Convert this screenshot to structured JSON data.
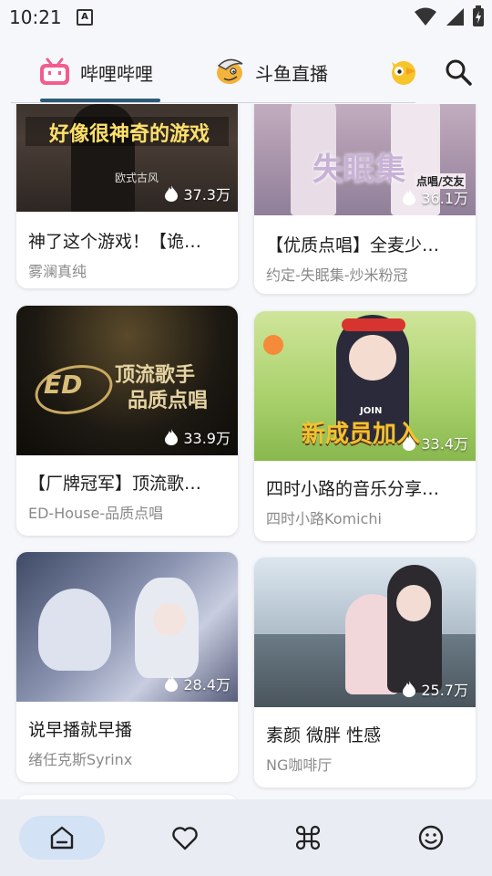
{
  "status_bar": {
    "time": "10:21",
    "notification_letter": "A",
    "icons": [
      "wifi-icon",
      "signal-icon",
      "battery-charging-icon"
    ]
  },
  "tabs": [
    {
      "label": "哔哩哔哩",
      "icon": "bilibili-icon",
      "selected": true
    },
    {
      "label": "斗鱼直播",
      "icon": "douyu-icon",
      "selected": false
    },
    {
      "label": "",
      "icon": "huya-icon",
      "selected": false
    }
  ],
  "search": {
    "icon": "search-icon"
  },
  "streams": [
    {
      "title": "神了这个游戏！【诡…",
      "streamer": "雾澜真纯",
      "viewers": "37.3万",
      "overlay": "好像很神奇的游戏",
      "overlay2": "欧式古风"
    },
    {
      "title": "【优质点唱】全麦少…",
      "streamer": "约定-失眠集-炒米粉冠",
      "viewers": "36.1万",
      "overlay": "失眠集",
      "overlay2": "点唱/交友"
    },
    {
      "title": "【厂牌冠军】顶流歌…",
      "streamer": "ED-House-品质点唱",
      "viewers": "33.9万",
      "overlay": "顶流歌手",
      "overlay2": "品质点唱"
    },
    {
      "title": "四时小路的音乐分享…",
      "streamer": "四时小路Komichi",
      "viewers": "33.4万",
      "overlay": "新成员加入",
      "overlay2": "JOIN"
    },
    {
      "title": "说早播就早播",
      "streamer": "绪任克斯Syrinx",
      "viewers": "28.4万",
      "overlay": "",
      "overlay2": ""
    },
    {
      "title": "素颜 微胖 性感",
      "streamer": "NG咖啡厅",
      "viewers": "25.7万",
      "overlay": "",
      "overlay2": ""
    }
  ],
  "bottom_nav": [
    {
      "icon": "home-icon",
      "selected": true
    },
    {
      "icon": "heart-icon",
      "selected": false
    },
    {
      "icon": "command-icon",
      "selected": false
    },
    {
      "icon": "smiley-icon",
      "selected": false
    }
  ],
  "colors": {
    "accent": "#2d5a7a",
    "nav_bg": "#e9edf3",
    "nav_active": "#d3e2f4"
  }
}
